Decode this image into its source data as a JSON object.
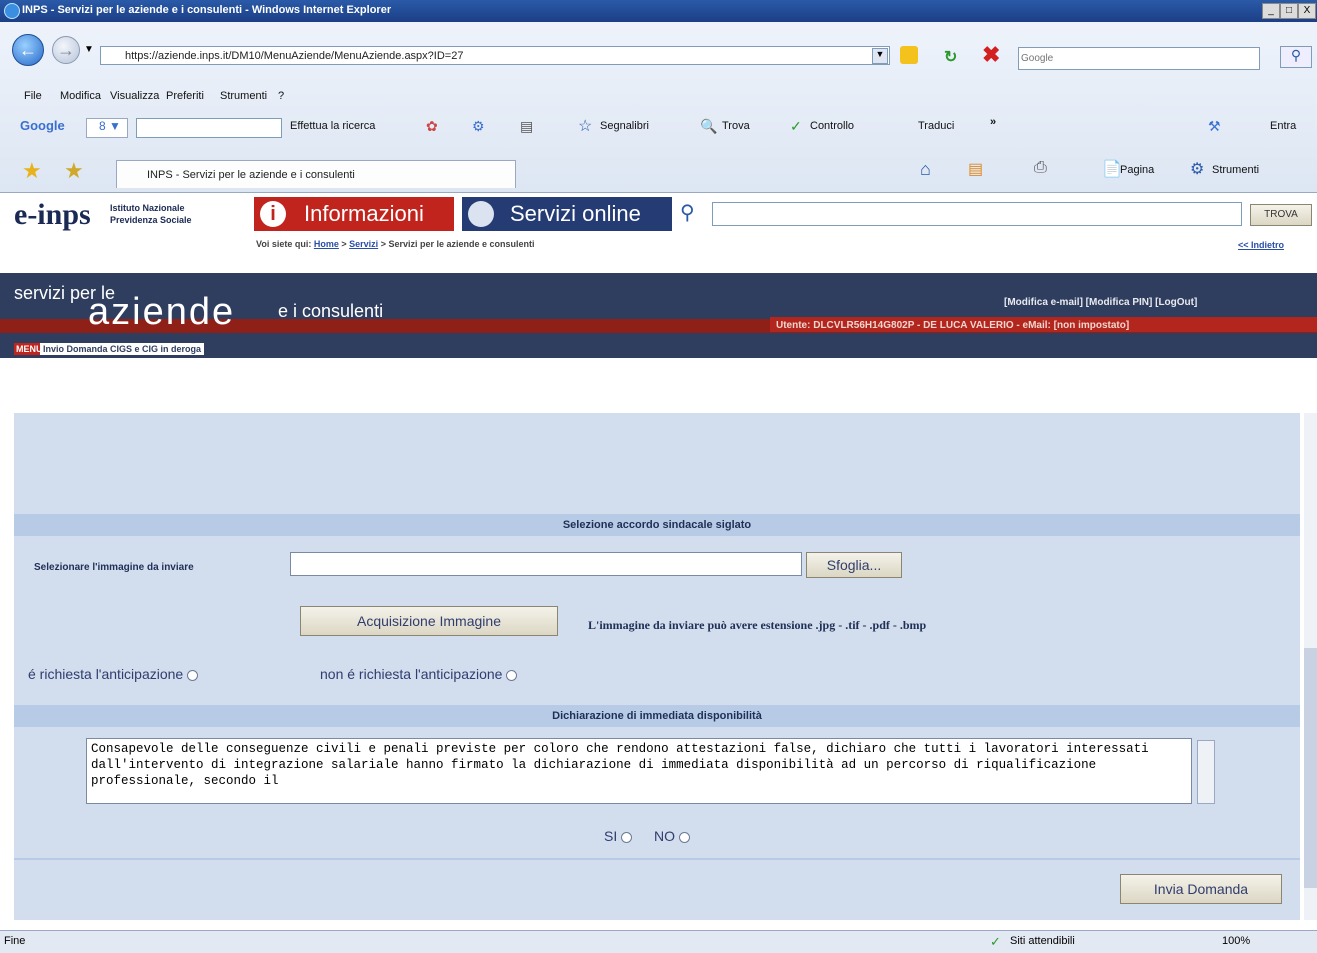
{
  "window": {
    "title": "INPS - Servizi per le aziende e i consulenti - Windows Internet Explorer",
    "controls": [
      "_",
      "□",
      "X"
    ]
  },
  "toolbar": {
    "address": "https://aziende.inps.it/DM10/MenuAziende/MenuAziende.aspx?ID=27",
    "search_placeholder": "Google",
    "menu": [
      "File",
      "Modifica",
      "Visualizza",
      "Preferiti",
      "Strumenti",
      "?"
    ],
    "google_label": "Google",
    "google_buttons": [
      "Effettua la ricerca",
      "Segnalibri",
      "Trova",
      "Controllo",
      "Traduci",
      "»"
    ],
    "entra": "Entra",
    "tab_title": "INPS - Servizi per le aziende e i consulenti",
    "right_tools": [
      "Pagina",
      "Strumenti"
    ]
  },
  "inps": {
    "logo": "e-inps",
    "logo_sub1": "Istituto Nazionale",
    "logo_sub2": "Previdenza Sociale",
    "tab_info": "Informazioni",
    "tab_services": "Servizi online",
    "search_button": "TROVA",
    "breadcrumb_prefix": "Voi siete qui:",
    "breadcrumb_home": "Home",
    "breadcrumb_servizi": "Servizi",
    "breadcrumb_current": "> Servizi per le aziende e consulenti",
    "back_link": "<< Indietro"
  },
  "banner": {
    "line1": "servizi per le",
    "big": "aziende",
    "suffix": "e i consulenti",
    "links": "[Modifica e-mail]  [Modifica PIN]  [LogOut]",
    "user": "Utente: DLCVLR56H14G802P - DE LUCA VALERIO - eMail: [non impostato]",
    "menu_label": "MENU",
    "menu_item": "Invio Domanda CIGS e CIG in deroga"
  },
  "form": {
    "section1": "Selezione accordo sindacale siglato",
    "select_label": "Selezionare l'immagine da inviare",
    "browse_button": "Sfoglia...",
    "acquire_button": "Acquisizione Immagine",
    "extension_note": "L'immagine da inviare può avere estensione .jpg - .tif - .pdf - .bmp",
    "radio_anticipo": "é richiesta l'anticipazione",
    "radio_no_anticipo": "non é richiesta l'anticipazione",
    "section2": "Dichiarazione di immediata disponibilità",
    "declaration": "Consapevole delle conseguenze civili e penali previste per coloro che rendono attestazioni false, dichiaro che tutti i lavoratori interessati dall'intervento di integrazione salariale hanno firmato la dichiarazione di immediata disponibilità ad un percorso di riqualificazione professionale, secondo il",
    "si": "SI",
    "no": "NO",
    "submit": "Invia Domanda"
  },
  "status": {
    "left": "Fine",
    "sites": "Siti attendibili",
    "zoom": "100%"
  }
}
